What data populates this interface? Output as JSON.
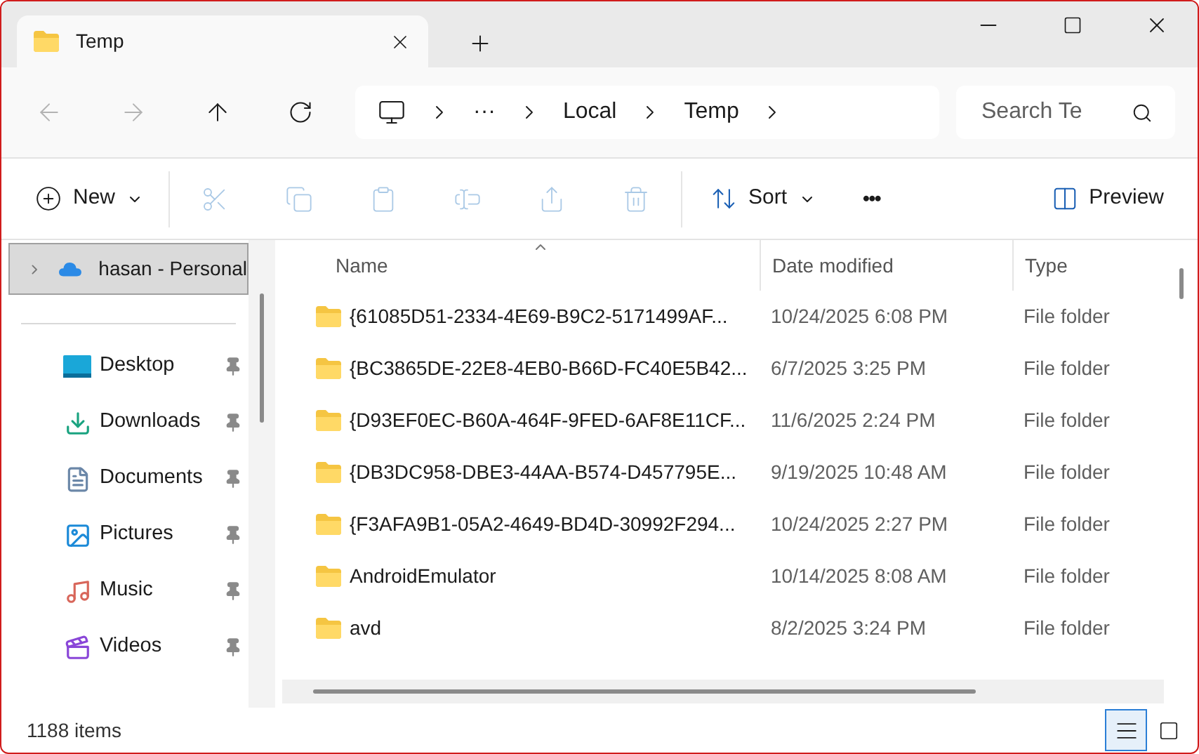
{
  "tab": {
    "title": "Temp"
  },
  "address": {
    "crumbs": [
      "···",
      "Local",
      "Temp"
    ]
  },
  "search": {
    "placeholder": "Search Te"
  },
  "toolbar": {
    "new_label": "New",
    "actions": [
      {
        "disabled": true
      },
      {
        "disabled": true
      },
      {
        "disabled": true
      },
      {
        "disabled": true
      },
      {
        "disabled": true
      },
      {
        "disabled": true
      }
    ],
    "sort_label": "Sort",
    "more_label": "•••",
    "preview_label": "Preview"
  },
  "nav": {
    "account": {
      "label": "hasan - Personal",
      "selected": true
    },
    "items": [
      {
        "label": "Desktop",
        "pinned": true
      },
      {
        "label": "Downloads",
        "pinned": true
      },
      {
        "label": "Documents",
        "pinned": true
      },
      {
        "label": "Pictures",
        "pinned": true
      },
      {
        "label": "Music",
        "pinned": true
      },
      {
        "label": "Videos",
        "pinned": true
      }
    ]
  },
  "table": {
    "columns": [
      "Name",
      "Date modified",
      "Type"
    ],
    "rows": [
      {
        "name": "{61085D51-2334-4E69-B9C2-5171499AF...",
        "date": "10/24/2025 6:08 PM",
        "type": "File folder"
      },
      {
        "name": "{BC3865DE-22E8-4EB0-B66D-FC40E5B42...",
        "date": "6/7/2025 3:25 PM",
        "type": "File folder"
      },
      {
        "name": "{D93EF0EC-B60A-464F-9FED-6AF8E11CF...",
        "date": "11/6/2025 2:24 PM",
        "type": "File folder"
      },
      {
        "name": "{DB3DC958-DBE3-44AA-B574-D457795E...",
        "date": "9/19/2025 10:48 AM",
        "type": "File folder"
      },
      {
        "name": "{F3AFA9B1-05A2-4649-BD4D-30992F294...",
        "date": "10/24/2025 2:27 PM",
        "type": "File folder"
      },
      {
        "name": "AndroidEmulator",
        "date": "10/14/2025 8:08 AM",
        "type": "File folder"
      },
      {
        "name": "avd",
        "date": "8/2/2025 3:24 PM",
        "type": "File folder"
      }
    ]
  },
  "status_bar": {
    "count": "1188 items"
  },
  "views": [
    {
      "selected": true
    },
    {
      "selected": false
    }
  ]
}
